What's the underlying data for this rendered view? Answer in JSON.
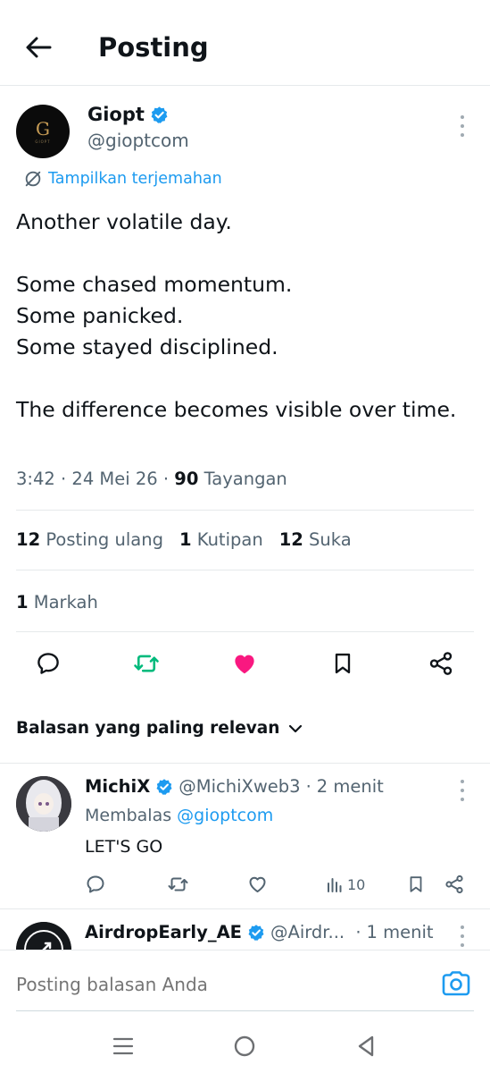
{
  "header": {
    "title": "Posting"
  },
  "post": {
    "author_name": "Giopt",
    "author_handle": "@gioptcom",
    "avatar_letter": "G",
    "avatar_sub": "GIOPT",
    "translate_label": "Tampilkan terjemahan",
    "lines": [
      "Another volatile day.",
      "",
      "Some chased momentum.",
      "Some panicked.",
      "Some stayed disciplined.",
      "",
      "The difference becomes visible over time."
    ],
    "time": "3:42",
    "date": "24 Mei 26",
    "views_count": "90",
    "views_label": "Tayangan",
    "reposts_count": "12",
    "reposts_label": "Posting ulang",
    "quotes_count": "1",
    "quotes_label": "Kutipan",
    "likes_count": "12",
    "likes_label": "Suka",
    "bookmarks_count": "1",
    "bookmarks_label": "Markah"
  },
  "sort": {
    "label": "Balasan yang paling relevan"
  },
  "replies": [
    {
      "name": "MichiX",
      "handle": "@MichiXweb3",
      "time": "2 menit",
      "replying_prefix": "Membalas",
      "replying_to": "@gioptcom",
      "text": "LET'S GO",
      "views": "10"
    },
    {
      "name": "AirdropEarly_AE",
      "handle": "@Airdr...",
      "time": "1 menit"
    }
  ],
  "composer": {
    "placeholder": "Posting balasan Anda"
  },
  "colors": {
    "accent": "#1d9bf0",
    "repost_active": "#00ba7c",
    "like_active": "#f91880",
    "secondary_text": "#536471"
  },
  "icons": {
    "back": "arrow-left-icon",
    "verified": "verified-badge-icon",
    "more": "more-vertical-icon",
    "translate": "translate-icon",
    "reply": "comment-icon",
    "repost": "repost-icon",
    "like": "heart-icon",
    "bookmark": "bookmark-icon",
    "share": "share-icon",
    "views": "bar-chart-icon",
    "camera": "camera-icon",
    "chevron": "chevron-down-icon"
  }
}
